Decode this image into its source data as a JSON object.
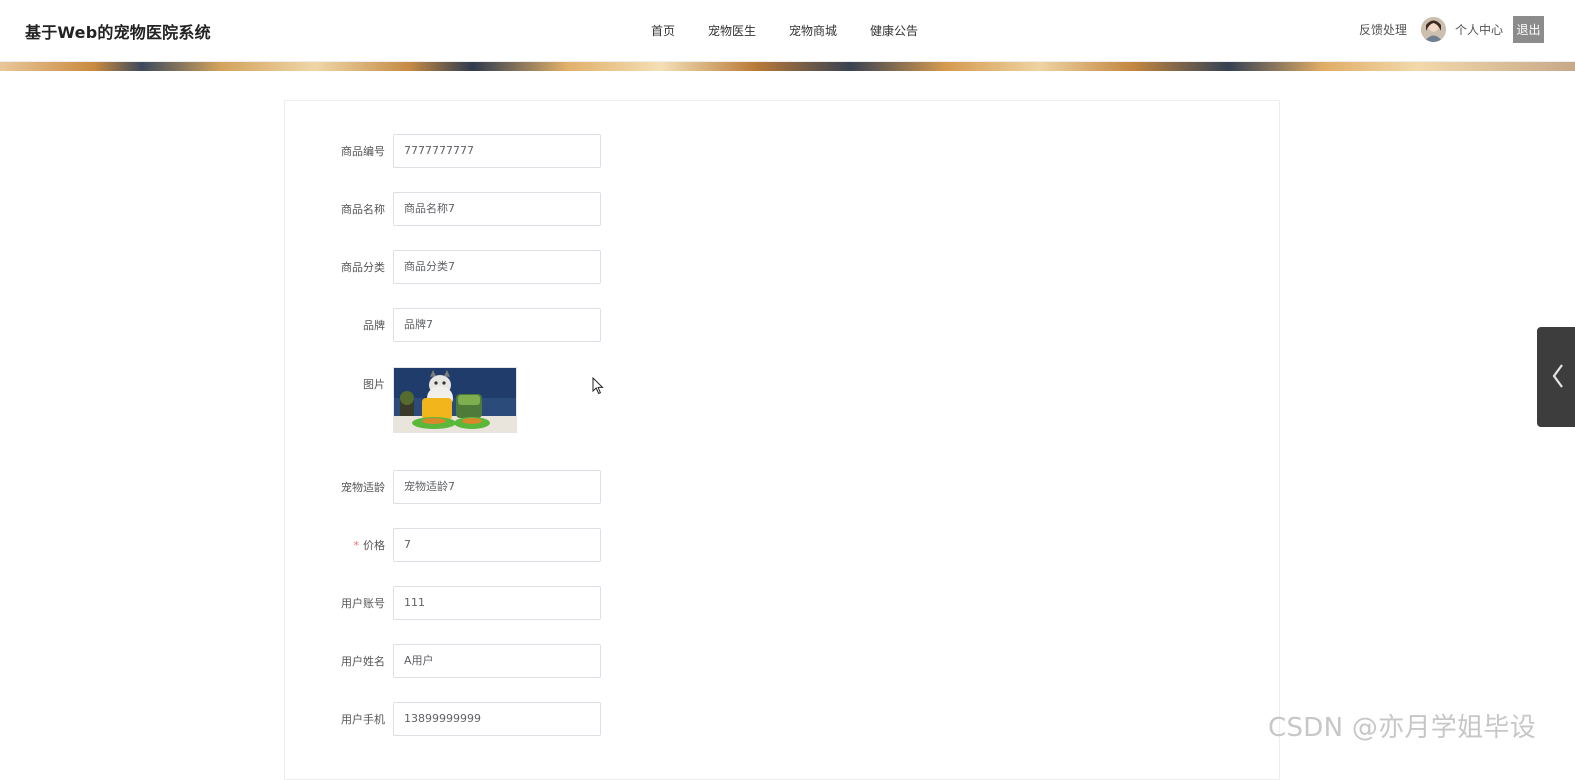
{
  "header": {
    "site_title": "基于Web的宠物医院系统",
    "nav": [
      {
        "label": "首页"
      },
      {
        "label": "宠物医生"
      },
      {
        "label": "宠物商城"
      },
      {
        "label": "健康公告"
      }
    ],
    "feedback_label": "反馈处理",
    "profile_label": "个人中心",
    "logout_label": "退出"
  },
  "form": {
    "fields": [
      {
        "label": "商品编号",
        "value": "7777777777",
        "required": false
      },
      {
        "label": "商品名称",
        "value": "商品名称7",
        "required": false
      },
      {
        "label": "商品分类",
        "value": "商品分类7",
        "required": false
      },
      {
        "label": "品牌",
        "value": "品牌7",
        "required": false
      },
      {
        "label": "图片",
        "type": "image",
        "required": false
      },
      {
        "label": "宠物适龄",
        "value": "宠物适龄7",
        "required": false
      },
      {
        "label": "价格",
        "value": "7",
        "required": true,
        "required_mark": "*"
      },
      {
        "label": "用户账号",
        "value": "111",
        "required": false
      },
      {
        "label": "用户姓名",
        "value": "A用户",
        "required": false
      },
      {
        "label": "用户手机",
        "value": "13899999999",
        "required": false
      }
    ]
  },
  "icons": {
    "side_panel": "chevron-left-icon",
    "cursor": "mouse-pointer-icon"
  },
  "watermark": "CSDN @亦月学姐毕设",
  "colors": {
    "logout_bg": "#8c8c8c",
    "side_panel_bg": "#3d3d3d",
    "required_star": "#f56c6c"
  }
}
